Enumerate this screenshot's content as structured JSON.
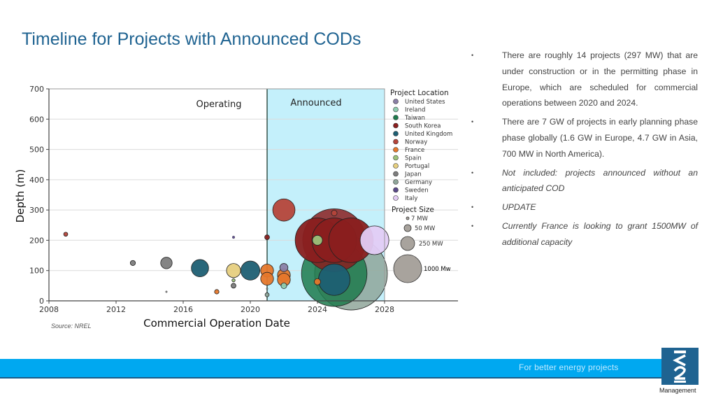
{
  "slide": {
    "title": "Timeline  for Projects with Announced CODs",
    "source": "Source: NREL",
    "tagline": "For better energy projects",
    "logo_text": "K2",
    "logo_subtitle": "Management",
    "bullet_glyph": "•",
    "bullets": [
      {
        "text": "There are roughly 14 projects  (297 MW) that are under  construction or in the permitting phase in Europe, which are  scheduled for commercial  operations between 2020 and 2024.",
        "italic": false
      },
      {
        "text": "There are 7 GW of projects in early planning phase phase globally (1.6 GW in Europe, 4.7 GW in Asia, 700 MW in North America).",
        "italic": false
      },
      {
        "text": "Not included: projects announced without an anticipated COD",
        "italic": true
      },
      {
        "text": "UPDATE",
        "italic": true
      },
      {
        "text": "Currently France  is looking to grant 1500MW of additional capacity",
        "italic": true
      }
    ]
  },
  "chart_data": {
    "type": "scatter",
    "title": "",
    "xlabel": "Commercial Operation Date",
    "ylabel": "Depth (m)",
    "xlim": [
      2008,
      2028
    ],
    "ylim": [
      0,
      700
    ],
    "xticks": [
      "2008",
      "2012",
      "2016",
      "2020",
      "2024",
      "2028"
    ],
    "yticks": [
      "0",
      "100",
      "200",
      "300",
      "400",
      "500",
      "600",
      "700"
    ],
    "grid": "horizontal",
    "regions": [
      {
        "label": "Operating",
        "x_range": [
          2008,
          2021
        ]
      },
      {
        "label": "Announced",
        "x_range": [
          2021,
          2028
        ],
        "color": "#c4f0fb"
      }
    ],
    "legend_location_title": "Project Location",
    "legend_size_title": "Project Size",
    "legend_placement": "right",
    "locations": [
      {
        "name": "United States",
        "color": "#8a7fa6"
      },
      {
        "name": "Ireland",
        "color": "#8fcdb0"
      },
      {
        "name": "Taiwan",
        "color": "#1d7a4c"
      },
      {
        "name": "South Korea",
        "color": "#8a1f1f"
      },
      {
        "name": "United Kingdom",
        "color": "#1e5f73"
      },
      {
        "name": "Norway",
        "color": "#b5443a"
      },
      {
        "name": "France",
        "color": "#e5772b"
      },
      {
        "name": "Spain",
        "color": "#9bc27a"
      },
      {
        "name": "Portugal",
        "color": "#e6cf7f"
      },
      {
        "name": "Japan",
        "color": "#7d7d7d"
      },
      {
        "name": "Germany",
        "color": "#8fa69a"
      },
      {
        "name": "Sweden",
        "color": "#5a4a8a"
      },
      {
        "name": "Italy",
        "color": "#e3ccf5"
      }
    ],
    "sizes": [
      {
        "label": "7 MW",
        "mw": 7
      },
      {
        "label": "50 MW",
        "mw": 50
      },
      {
        "label": "250 MW",
        "mw": 250
      },
      {
        "label": "1000 Mw",
        "mw": 1000
      }
    ],
    "points": [
      {
        "x": 2009.0,
        "y": 220,
        "mw": 5,
        "loc": "Norway"
      },
      {
        "x": 2013.0,
        "y": 125,
        "mw": 8,
        "loc": "Japan"
      },
      {
        "x": 2015.0,
        "y": 125,
        "mw": 40,
        "loc": "Japan"
      },
      {
        "x": 2015.0,
        "y": 30,
        "mw": 1,
        "loc": "Japan"
      },
      {
        "x": 2017.0,
        "y": 108,
        "mw": 90,
        "loc": "United Kingdom"
      },
      {
        "x": 2018.0,
        "y": 30,
        "mw": 6,
        "loc": "France"
      },
      {
        "x": 2019.0,
        "y": 100,
        "mw": 60,
        "loc": "Portugal"
      },
      {
        "x": 2019.0,
        "y": 68,
        "mw": 3,
        "loc": "Spain"
      },
      {
        "x": 2019.0,
        "y": 50,
        "mw": 7,
        "loc": "Japan"
      },
      {
        "x": 2019.0,
        "y": 210,
        "mw": 2,
        "loc": "Sweden"
      },
      {
        "x": 2020.0,
        "y": 100,
        "mw": 110,
        "loc": "United Kingdom"
      },
      {
        "x": 2021.0,
        "y": 100,
        "mw": 50,
        "loc": "France"
      },
      {
        "x": 2021.0,
        "y": 73,
        "mw": 50,
        "loc": "France"
      },
      {
        "x": 2021.0,
        "y": 210,
        "mw": 7,
        "loc": "South Korea"
      },
      {
        "x": 2021.0,
        "y": 40,
        "mw": 1,
        "loc": "Japan"
      },
      {
        "x": 2021.0,
        "y": 20,
        "mw": 5,
        "loc": "Germany"
      },
      {
        "x": 2022.0,
        "y": 300,
        "mw": 150,
        "loc": "Norway"
      },
      {
        "x": 2022.0,
        "y": 110,
        "mw": 20,
        "loc": "United States"
      },
      {
        "x": 2022.0,
        "y": 85,
        "mw": 50,
        "loc": "France"
      },
      {
        "x": 2022.0,
        "y": 70,
        "mw": 50,
        "loc": "France"
      },
      {
        "x": 2022.0,
        "y": 50,
        "mw": 10,
        "loc": "Ireland"
      },
      {
        "x": 2026.0,
        "y": 90,
        "mw": 1600,
        "loc": "Germany"
      },
      {
        "x": 2025.0,
        "y": 200,
        "mw": 1200,
        "loc": "South Korea"
      },
      {
        "x": 2025.0,
        "y": 90,
        "mw": 1300,
        "loc": "Taiwan"
      },
      {
        "x": 2024.0,
        "y": 200,
        "mw": 600,
        "loc": "South Korea"
      },
      {
        "x": 2025.0,
        "y": 200,
        "mw": 600,
        "loc": "South Korea"
      },
      {
        "x": 2026.0,
        "y": 200,
        "mw": 600,
        "loc": "South Korea"
      },
      {
        "x": 2025.0,
        "y": 70,
        "mw": 300,
        "loc": "United Kingdom"
      },
      {
        "x": 2025.0,
        "y": 290,
        "mw": 10,
        "loc": "Norway"
      },
      {
        "x": 2024.0,
        "y": 200,
        "mw": 30,
        "loc": "Spain"
      },
      {
        "x": 2024.0,
        "y": 63,
        "mw": 12,
        "loc": "France"
      },
      {
        "x": 2027.4,
        "y": 200,
        "mw": 250,
        "loc": "Italy"
      }
    ]
  }
}
